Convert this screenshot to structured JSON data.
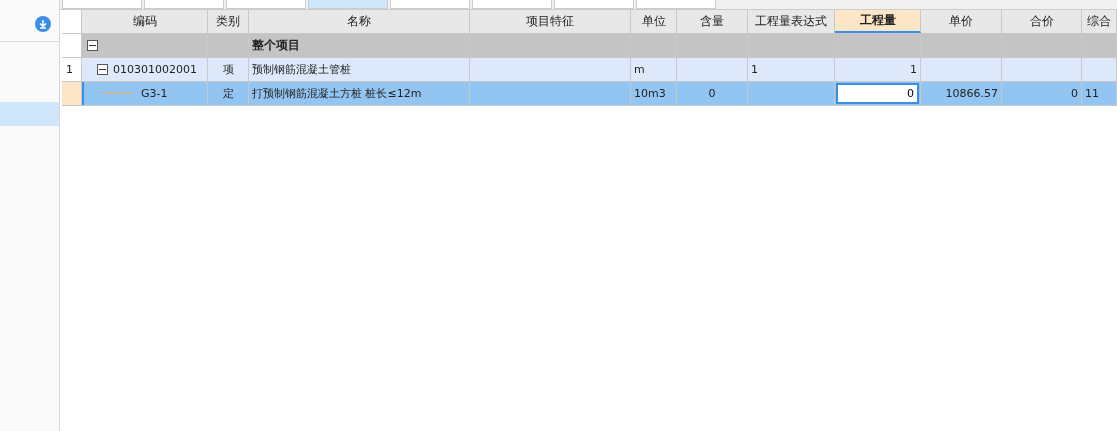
{
  "tabs": [
    {
      "selected": false
    },
    {
      "selected": false
    },
    {
      "selected": false
    },
    {
      "selected": true
    },
    {
      "selected": false
    },
    {
      "selected": false
    },
    {
      "selected": false
    },
    {
      "selected": false
    }
  ],
  "columns": [
    {
      "label": "编码",
      "selected": false
    },
    {
      "label": "类别",
      "selected": false
    },
    {
      "label": "名称",
      "selected": false
    },
    {
      "label": "项目特征",
      "selected": false
    },
    {
      "label": "单位",
      "selected": false
    },
    {
      "label": "含量",
      "selected": false
    },
    {
      "label": "工程量表达式",
      "selected": false
    },
    {
      "label": "工程量",
      "selected": true
    },
    {
      "label": "单价",
      "selected": false
    },
    {
      "label": "合价",
      "selected": false
    },
    {
      "label": "综合",
      "selected": false
    }
  ],
  "rows": [
    {
      "kind": "group",
      "number": "",
      "expanded": true,
      "selected": false,
      "cells": [
        "",
        "",
        "整个项目",
        "",
        "",
        "",
        "",
        "",
        "",
        "",
        ""
      ]
    },
    {
      "kind": "item",
      "number": "1",
      "expanded": true,
      "selected": false,
      "cells": [
        "010301002001",
        "项",
        "预制钢筋混凝土管桩",
        "",
        "m",
        "",
        "1",
        "1",
        "",
        "",
        ""
      ]
    },
    {
      "kind": "quota",
      "number": "",
      "selected": true,
      "cells": [
        "G3-1",
        "定",
        "打预制钢筋混凝土方桩 桩长≤12m",
        "",
        "10m3",
        "0",
        "",
        "0",
        "10866.57",
        "0",
        "11"
      ]
    }
  ]
}
